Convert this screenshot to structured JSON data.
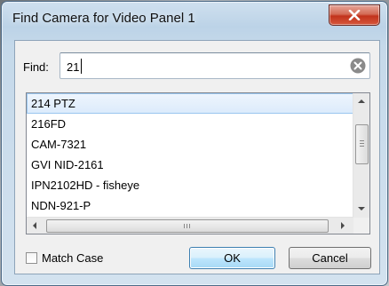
{
  "window": {
    "title": "Find Camera for Video Panel 1"
  },
  "find": {
    "label": "Find:",
    "value": "21"
  },
  "results": [
    "214 PTZ",
    "216FD",
    "CAM-7321",
    "GVI NID-2161",
    "IPN2102HD - fisheye",
    "NDN-921-P"
  ],
  "selected_index": 0,
  "match_case": {
    "label": "Match Case",
    "checked": false
  },
  "buttons": {
    "ok": "OK",
    "cancel": "Cancel"
  },
  "icons": {
    "close": "close-x-icon",
    "clear": "clear-search-icon",
    "scroll_up": "arrow-up-icon",
    "scroll_down": "arrow-down-icon",
    "scroll_left": "arrow-left-icon",
    "scroll_right": "arrow-right-icon"
  },
  "colors": {
    "close_button": "#c8432b",
    "selection": "#dcebfc",
    "ok_button": "#bee6fd"
  }
}
